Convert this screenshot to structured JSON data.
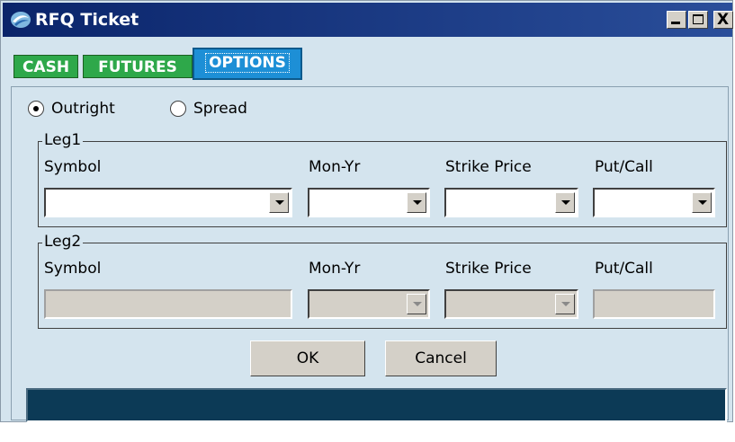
{
  "window": {
    "title": "RFQ Ticket"
  },
  "titlebar_buttons": {
    "min": "_",
    "max": "□",
    "close": "X"
  },
  "tabs": [
    {
      "label": "CASH"
    },
    {
      "label": "FUTURES"
    },
    {
      "label": "OPTIONS",
      "selected": true
    }
  ],
  "mode": {
    "options": [
      "Outright",
      "Spread"
    ],
    "selected": "Outright"
  },
  "leg1": {
    "title": "Leg1",
    "labels": {
      "symbol": "Symbol",
      "mon_yr": "Mon-Yr",
      "strike": "Strike Price",
      "putcall": "Put/Call"
    },
    "values": {
      "symbol": "",
      "mon_yr": "",
      "strike": "",
      "putcall": ""
    }
  },
  "leg2": {
    "title": "Leg2",
    "labels": {
      "symbol": "Symbol",
      "mon_yr": "Mon-Yr",
      "strike": "Strike Price",
      "putcall": "Put/Call"
    },
    "values": {
      "symbol": "",
      "mon_yr": "",
      "strike": "",
      "putcall": ""
    }
  },
  "buttons": {
    "ok": "OK",
    "cancel": "Cancel"
  },
  "status": {
    "text": ""
  },
  "colors": {
    "titlebar": "#0a246a",
    "tab_green": "#2ea84a",
    "tab_selected": "#1d8fd6",
    "panel": "#d4e4ee",
    "status": "#0c3a56"
  }
}
